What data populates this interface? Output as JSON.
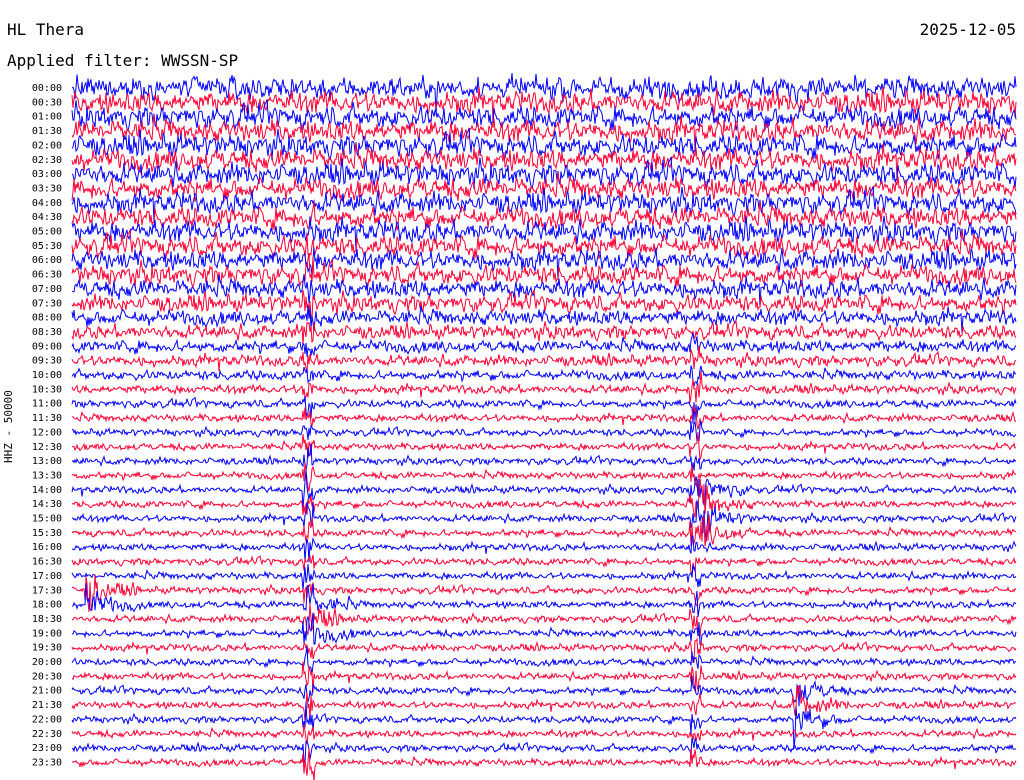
{
  "header": {
    "station": "HL Thera",
    "date": "2025-12-05",
    "filter": "Applied filter: WWSSN-SP"
  },
  "channel_label": "HHZ - 50000",
  "colors": {
    "trace_a": "#0000ff",
    "trace_b": "#ff0033",
    "background": "#ffffff",
    "text": "#000000"
  },
  "chart_data": {
    "type": "line",
    "subtype": "helicorder",
    "title": "HL Thera",
    "subtitle": "Applied filter: WWSSN-SP",
    "ylabel": "HHZ - 50000",
    "time_labels": [
      "00:00",
      "00:30",
      "01:00",
      "01:30",
      "02:00",
      "02:30",
      "03:00",
      "03:30",
      "04:00",
      "04:30",
      "05:00",
      "05:30",
      "06:00",
      "06:30",
      "07:00",
      "07:30",
      "08:00",
      "08:30",
      "09:00",
      "09:30",
      "10:00",
      "10:30",
      "11:00",
      "11:30",
      "12:00",
      "12:30",
      "13:00",
      "13:30",
      "14:00",
      "14:30",
      "15:00",
      "15:30",
      "16:00",
      "16:30",
      "17:00",
      "17:30",
      "18:00",
      "18:30",
      "19:00",
      "19:30",
      "20:00",
      "20:30",
      "21:00",
      "21:30",
      "22:00",
      "22:30",
      "23:00",
      "23:30"
    ],
    "trace_colors": [
      "#0000ff",
      "#ff0033"
    ],
    "row_noise_levels": [
      0.95,
      0.95,
      0.95,
      0.95,
      0.95,
      0.95,
      0.95,
      0.92,
      0.9,
      0.9,
      0.9,
      0.88,
      0.85,
      0.82,
      0.78,
      0.7,
      0.62,
      0.55,
      0.45,
      0.4,
      0.32,
      0.28,
      0.24,
      0.22,
      0.2,
      0.2,
      0.2,
      0.2,
      0.2,
      0.2,
      0.2,
      0.2,
      0.2,
      0.2,
      0.2,
      0.2,
      0.2,
      0.2,
      0.2,
      0.2,
      0.2,
      0.2,
      0.2,
      0.2,
      0.2,
      0.2,
      0.2,
      0.2
    ],
    "events": [
      {
        "row_from": 9,
        "row_to": 47,
        "x_fraction": 0.25,
        "description": "persistent spike column"
      },
      {
        "row_from": 18,
        "row_to": 47,
        "x_fraction": 0.66,
        "description": "persistent spike column"
      },
      {
        "row_from": 28,
        "row_to": 31,
        "x_fraction": 0.67,
        "description": "large event with coda"
      },
      {
        "row_from": 36,
        "row_to": 38,
        "x_fraction": 0.25,
        "description": "event"
      },
      {
        "row_from": 42,
        "row_to": 44,
        "x_fraction": 0.77,
        "description": "event"
      },
      {
        "row_from": 35,
        "row_to": 36,
        "x_fraction": 0.02,
        "description": "event"
      }
    ]
  }
}
